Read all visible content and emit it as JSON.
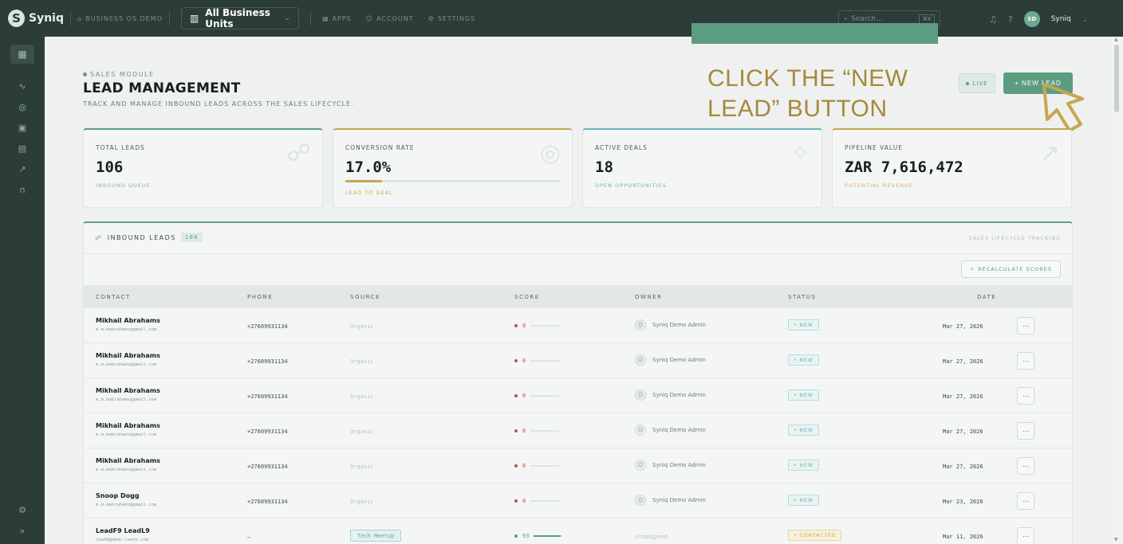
{
  "topbar": {
    "logo": "Syniq",
    "breadcrumb": "BUSINESS OS DEMO",
    "business_unit": "All Business Units",
    "links": [
      "APPS",
      "ACCOUNT",
      "SETTINGS"
    ],
    "search_placeholder": "Search...",
    "search_shortcut": "⌘K",
    "user_initials": "SD",
    "user_name": "Syniq"
  },
  "header": {
    "module_tag": "SALES MODULE",
    "title": "LEAD MANAGEMENT",
    "subtitle": "TRACK AND MANAGE INBOUND LEADS ACROSS THE SALES LIFECYCLE.",
    "live_label": "LIVE",
    "new_lead_label": "+ NEW LEAD",
    "tutorial_text": "CLICK THE “NEW LEAD” BUTTON"
  },
  "stats": [
    {
      "label": "TOTAL LEADS",
      "value": "106",
      "sub": "INBOUND QUEUE"
    },
    {
      "label": "CONVERSION RATE",
      "value": "17.0%",
      "sub": "LEAD TO DEAL",
      "progress": 0.17
    },
    {
      "label": "ACTIVE DEALS",
      "value": "18",
      "sub": "OPEN OPPORTUNITIES"
    },
    {
      "label": "PIPELINE VALUE",
      "value": "ZAR 7,616,472",
      "sub": "POTENTIAL REVENUE"
    }
  ],
  "table": {
    "title": "INBOUND LEADS",
    "count": "106",
    "right_label": "SALES LIFECYCLE TRACKING",
    "recalculate_label": "RECALCULATE SCORES",
    "columns": [
      "CONTACT",
      "PHONE",
      "SOURCE",
      "SCORE",
      "OWNER",
      "STATUS",
      "DATE"
    ],
    "rows": [
      {
        "name": "Mikhail Abrahams",
        "email": "m.m.mabrahams@gmail.com",
        "phone": "+27609931134",
        "source": "Organic",
        "score": "0",
        "score_pct": 0,
        "owner": "Syniq Demo Admin",
        "status": "NEW",
        "date": "Mar 27, 2026"
      },
      {
        "name": "Mikhail Abrahams",
        "email": "m.m.mabrahams@gmail.com",
        "phone": "+27609931134",
        "source": "Organic",
        "score": "0",
        "score_pct": 0,
        "owner": "Syniq Demo Admin",
        "status": "NEW",
        "date": "Mar 27, 2026"
      },
      {
        "name": "Mikhail Abrahams",
        "email": "m.m.mabrahams@gmail.com",
        "phone": "+27609931134",
        "source": "Organic",
        "score": "0",
        "score_pct": 0,
        "owner": "Syniq Demo Admin",
        "status": "NEW",
        "date": "Mar 27, 2026"
      },
      {
        "name": "Mikhail Abrahams",
        "email": "m.m.mabrahams@gmail.com",
        "phone": "+27609931134",
        "source": "Organic",
        "score": "0",
        "score_pct": 0,
        "owner": "Syniq Demo Admin",
        "status": "NEW",
        "date": "Mar 27, 2026"
      },
      {
        "name": "Mikhail Abrahams",
        "email": "m.m.mabrahams@gmail.com",
        "phone": "+27609931134",
        "source": "Organic",
        "score": "0",
        "score_pct": 0,
        "owner": "Syniq Demo Admin",
        "status": "NEW",
        "date": "Mar 27, 2026"
      },
      {
        "name": "Snoop Dogg",
        "email": "m.m.mabrahams@gmail.com",
        "phone": "+27609931134",
        "source": "Organic",
        "score": "0",
        "score_pct": 0,
        "owner": "Syniq Demo Admin",
        "status": "NEW",
        "date": "Mar 23, 2026"
      },
      {
        "name": "LeadF9 LeadL9",
        "email": "lead9@demo-leads.com",
        "phone": "–",
        "source": "Tech Meetup",
        "score": "93",
        "score_pct": 0.93,
        "owner": "Unassigned",
        "status": "CONTACTED",
        "date": "Mar 11, 2026"
      }
    ]
  },
  "colors": {
    "accent": "#5e9c82",
    "topbar": "#2c3c39",
    "gold": "#c7a650",
    "teal": "#67b3bd",
    "tutorial": "#a7883c"
  },
  "icons": {
    "sidebar": [
      "grid-icon",
      "activity-icon",
      "target-icon",
      "dollar-icon",
      "calendar-icon",
      "trending-icon",
      "headset-icon",
      "settings-icon",
      "expand-icon"
    ]
  }
}
